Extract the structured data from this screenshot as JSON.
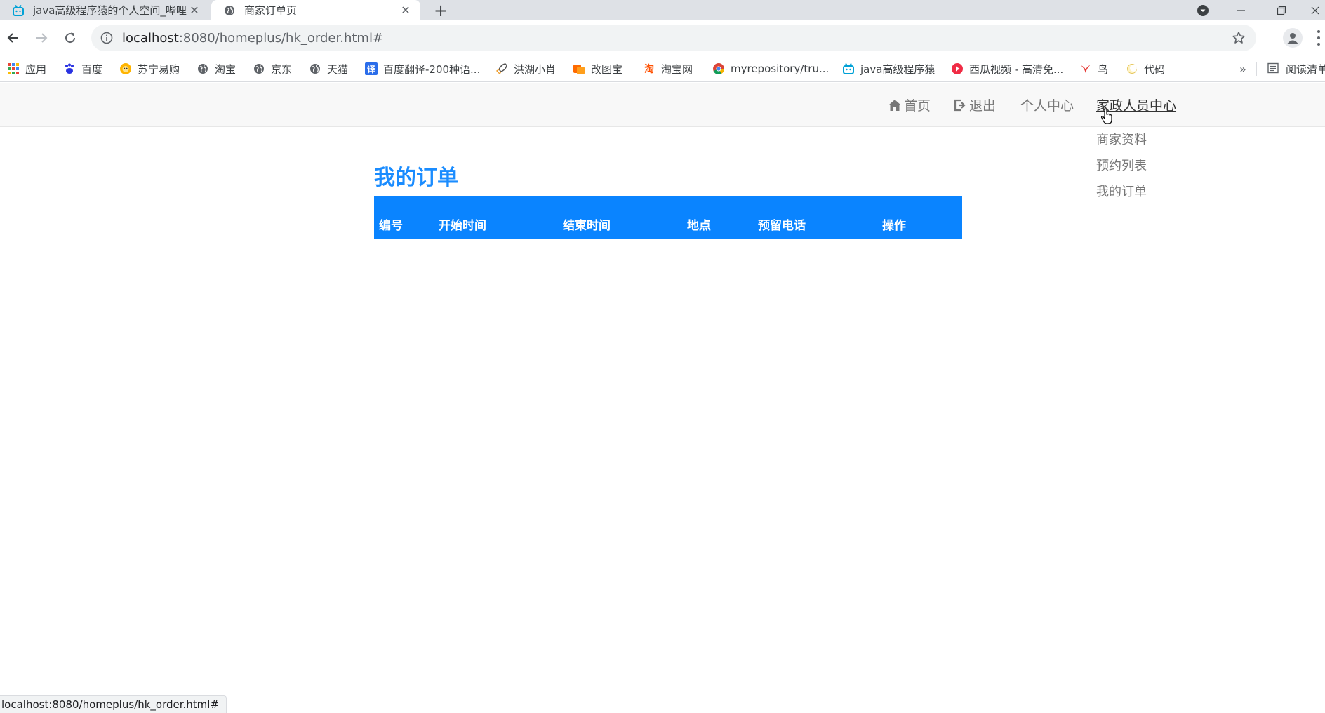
{
  "browser": {
    "tabs": [
      {
        "title": "java高级程序猿的个人空间_哔哩",
        "active": false
      },
      {
        "title": "商家订单页",
        "active": true
      }
    ],
    "url_host": "localhost",
    "url_rest": ":8080/homeplus/hk_order.html#",
    "bookmarks": [
      {
        "label": "应用",
        "icon": "apps-grid-icon"
      },
      {
        "label": "百度",
        "icon": "baidu-paw-icon"
      },
      {
        "label": "苏宁易购",
        "icon": "suning-lion-icon"
      },
      {
        "label": "淘宝",
        "icon": "globe-icon"
      },
      {
        "label": "京东",
        "icon": "globe-icon"
      },
      {
        "label": "天猫",
        "icon": "globe-icon"
      },
      {
        "label": "百度翻译-200种语...",
        "icon": "translate-icon"
      },
      {
        "label": "洪湖小肖",
        "icon": "rocket-icon"
      },
      {
        "label": "改图宝",
        "icon": "image-edit-icon"
      },
      {
        "label": "淘宝网",
        "icon": "taobao-icon"
      },
      {
        "label": "myrepository/tru...",
        "icon": "chrome-icon"
      },
      {
        "label": "java高级程序猿",
        "icon": "bilibili-icon"
      },
      {
        "label": "西瓜视频 - 高清免...",
        "icon": "play-icon"
      },
      {
        "label": "鸟",
        "icon": "bird-icon"
      },
      {
        "label": "代码",
        "icon": "moon-icon"
      }
    ],
    "more_label": "»",
    "reading_list_label": "阅读清单",
    "status_url": "localhost:8080/homeplus/hk_order.html#"
  },
  "nav": {
    "home": "首页",
    "logout": "退出",
    "personal": "个人中心",
    "staff_center": "家政人员中心",
    "dropdown": [
      "商家资料",
      "预约列表",
      "我的订单"
    ]
  },
  "main": {
    "title": "我的订单",
    "columns": [
      "编号",
      "开始时间",
      "结束时间",
      "地点",
      "预留电话",
      "操作"
    ]
  },
  "colors": {
    "accent": "#0a84ff",
    "title": "#1a8cff",
    "nav_bg": "#f8f8f8"
  }
}
